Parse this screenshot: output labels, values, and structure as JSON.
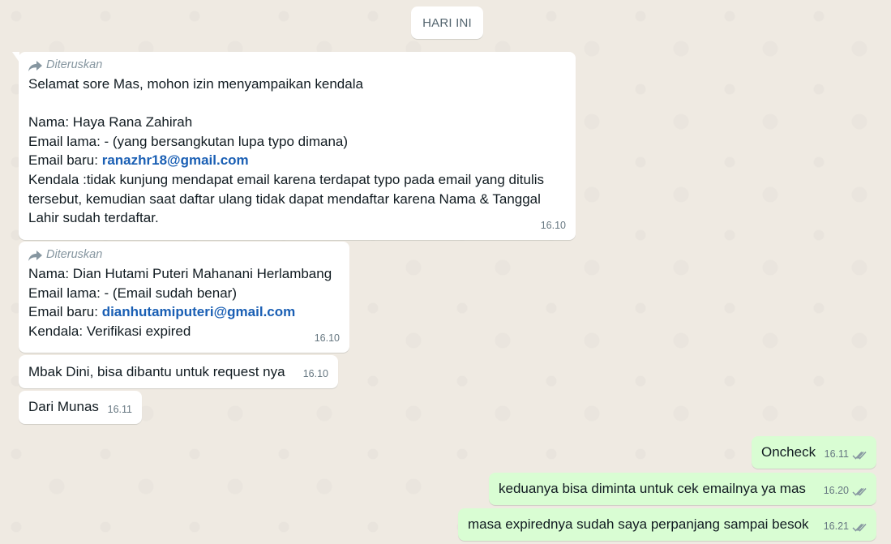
{
  "date_chip": "HARI INI",
  "forwarded_label": "Diteruskan",
  "messages": {
    "m1": {
      "greeting": "Selamat sore Mas, mohon izin menyampaikan kendala",
      "nama": "Nama: Haya Rana Zahirah",
      "email_lama": "Email lama: - (yang bersangkutan lupa typo dimana)",
      "email_baru_label": "Email baru: ",
      "email_baru": "ranazhr18@gmail.com",
      "kendala_1": "Kendala :tidak kunjung mendapat email karena terdapat typo pada email yang ditulis",
      "kendala_2": "tersebut, kemudian saat daftar ulang tidak dapat mendaftar karena Nama & Tanggal",
      "kendala_3": "Lahir sudah terdaftar.",
      "time": "16.10"
    },
    "m2": {
      "nama": "Nama: Dian Hutami Puteri Mahanani Herlambang",
      "email_lama": "Email lama: - (Email sudah benar)",
      "email_baru_label": "Email baru: ",
      "email_baru": "dianhutamiputeri@gmail.com",
      "kendala": "Kendala: Verifikasi expired",
      "time": "16.10"
    },
    "m3": {
      "text": "Mbak Dini, bisa dibantu untuk request nya",
      "time": "16.10"
    },
    "m4": {
      "text": "Dari Munas",
      "time": "16.11"
    },
    "m5": {
      "text": "Oncheck",
      "time": "16.11"
    },
    "m6": {
      "text": "keduanya bisa diminta untuk cek emailnya ya mas",
      "time": "16.20"
    },
    "m7": {
      "text": "masa expirednya sudah saya perpanjang sampai besok",
      "time": "16.21"
    }
  },
  "colors": {
    "background": "#efeae2",
    "incoming_bubble": "#ffffff",
    "outgoing_bubble": "#d9fdd3",
    "email_link": "#1a5fb4",
    "read_ticks": "#8696a0"
  },
  "icons": {
    "forward": "forward-arrow-icon",
    "read_status": "double-check-icon"
  }
}
